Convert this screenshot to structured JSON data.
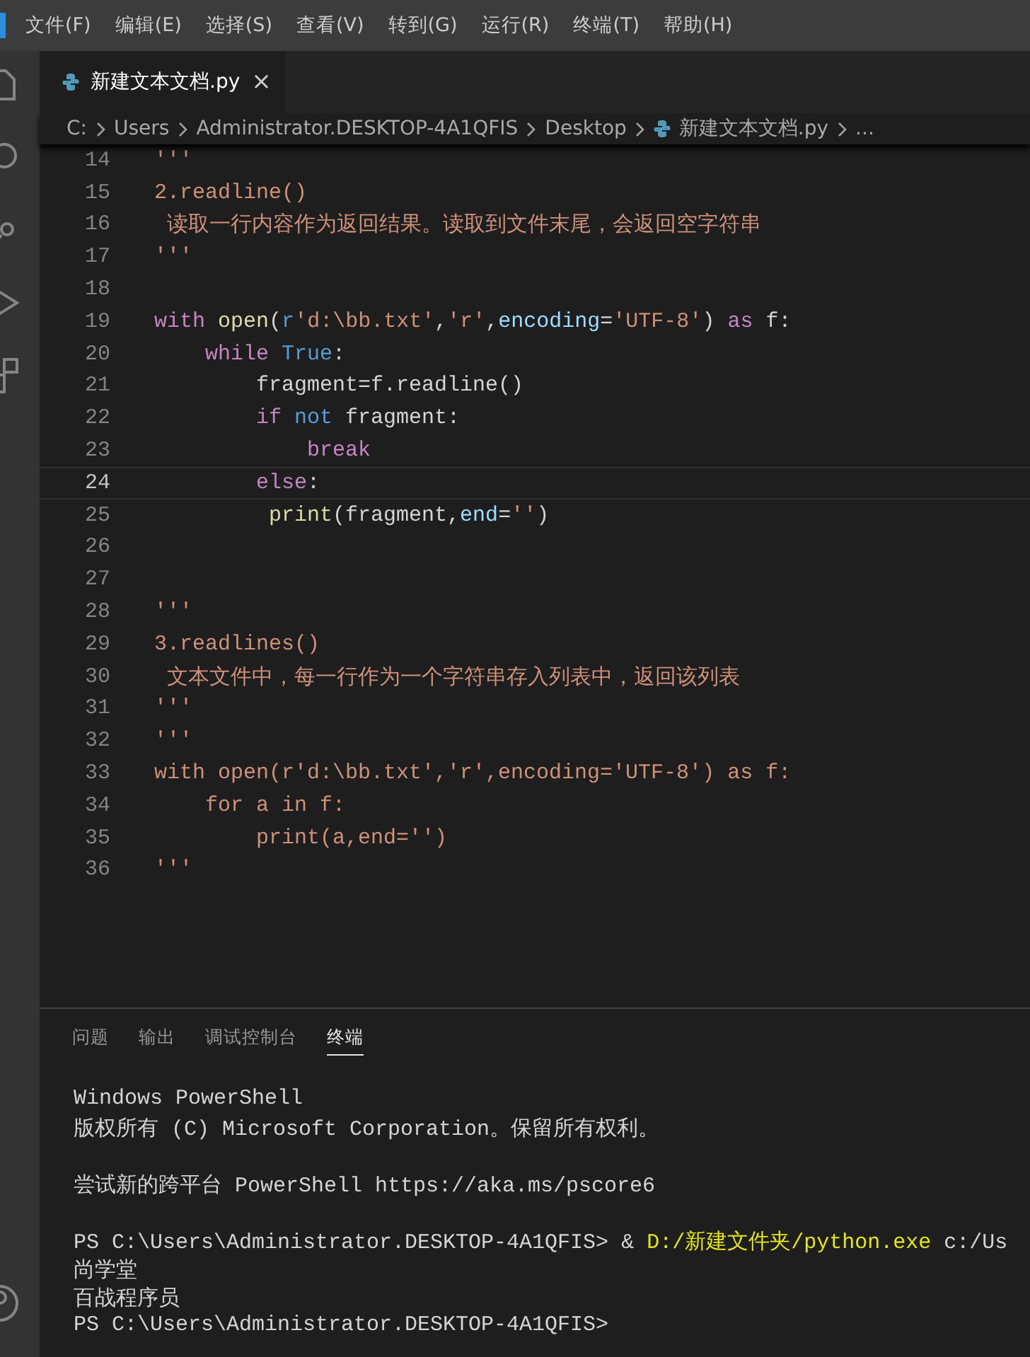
{
  "menu_bar": {
    "items": [
      "文件(F)",
      "编辑(E)",
      "选择(S)",
      "查看(V)",
      "转到(G)",
      "运行(R)",
      "终端(T)",
      "帮助(H)"
    ]
  },
  "tabs": [
    {
      "label": "新建文本文档.py",
      "selected": true
    }
  ],
  "tab_close": "×",
  "breadcrumb": [
    {
      "kind": "text",
      "label": "C:"
    },
    {
      "kind": "text",
      "label": "Users"
    },
    {
      "kind": "text",
      "label": "Administrator.DESKTOP-4A1QFIS"
    },
    {
      "kind": "text",
      "label": "Desktop"
    },
    {
      "kind": "file",
      "label": "新建文本文档.py"
    },
    {
      "kind": "text",
      "label": "..."
    }
  ],
  "code_lines": [
    {
      "number": "14",
      "current": false,
      "tokens": [
        {
          "kind": "str",
          "text": "'''"
        }
      ]
    },
    {
      "number": "15",
      "current": false,
      "tokens": [
        {
          "kind": "str",
          "text": "2.readline()"
        }
      ]
    },
    {
      "number": "16",
      "current": false,
      "tokens": [
        {
          "kind": "str",
          "text": " 读取一行内容作为返回结果。读取到文件末尾，会返回空字符串"
        }
      ]
    },
    {
      "number": "17",
      "current": false,
      "tokens": [
        {
          "kind": "str",
          "text": "'''"
        }
      ]
    },
    {
      "number": "18",
      "current": false
    },
    {
      "number": "19",
      "current": false,
      "tokens": [
        {
          "kind": "kw",
          "text": "with"
        },
        {
          "kind": "fn",
          "text": " open"
        },
        {
          "kind": "plain",
          "text": "("
        },
        {
          "kind": "kw2",
          "text": "r"
        },
        {
          "kind": "str",
          "text": "'d:\\bb.txt'"
        },
        {
          "kind": "plain",
          "text": ","
        },
        {
          "kind": "str",
          "text": "'r'"
        },
        {
          "kind": "plain",
          "text": ","
        },
        {
          "kind": "param",
          "text": "encoding"
        },
        {
          "kind": "plain",
          "text": "="
        },
        {
          "kind": "str",
          "text": "'UTF-8'"
        },
        {
          "kind": "plain",
          "text": ")"
        },
        {
          "kind": "kw",
          "text": " as"
        },
        {
          "kind": "plain",
          "text": " f:"
        }
      ]
    },
    {
      "number": "20",
      "current": false,
      "tokens": [
        {
          "kind": "kw",
          "text": "    while"
        },
        {
          "kind": "kw2",
          "text": " True"
        },
        {
          "kind": "plain",
          "text": ":"
        }
      ]
    },
    {
      "number": "21",
      "current": false,
      "tokens": [
        {
          "kind": "plain",
          "text": "        fragment=f.readline()"
        }
      ]
    },
    {
      "number": "22",
      "current": false,
      "tokens": [
        {
          "kind": "kw",
          "text": "        if"
        },
        {
          "kind": "kw2",
          "text": " not"
        },
        {
          "kind": "plain",
          "text": " fragment:"
        }
      ]
    },
    {
      "number": "23",
      "current": false,
      "tokens": [
        {
          "kind": "kw",
          "text": "            break"
        }
      ]
    },
    {
      "number": "24",
      "current": true,
      "tokens": [
        {
          "kind": "kw",
          "text": "        else"
        },
        {
          "kind": "plain",
          "text": ":"
        }
      ]
    },
    {
      "number": "25",
      "current": false,
      "tokens": [
        {
          "kind": "fn",
          "text": "         print"
        },
        {
          "kind": "plain",
          "text": "(fragment,"
        },
        {
          "kind": "param",
          "text": "end"
        },
        {
          "kind": "plain",
          "text": "="
        },
        {
          "kind": "str",
          "text": "''"
        },
        {
          "kind": "plain",
          "text": ")"
        }
      ]
    },
    {
      "number": "26",
      "current": false
    },
    {
      "number": "27",
      "current": false
    },
    {
      "number": "28",
      "current": false,
      "tokens": [
        {
          "kind": "str",
          "text": "'''"
        }
      ]
    },
    {
      "number": "29",
      "current": false,
      "tokens": [
        {
          "kind": "str",
          "text": "3.readlines()"
        }
      ]
    },
    {
      "number": "30",
      "current": false,
      "tokens": [
        {
          "kind": "str",
          "text": " 文本文件中，每一行作为一个字符串存入列表中，返回该列表"
        }
      ]
    },
    {
      "number": "31",
      "current": false,
      "tokens": [
        {
          "kind": "str",
          "text": "'''"
        }
      ]
    },
    {
      "number": "32",
      "current": false,
      "tokens": [
        {
          "kind": "str",
          "text": "'''"
        }
      ]
    },
    {
      "number": "33",
      "current": false,
      "tokens": [
        {
          "kind": "str",
          "text": "with open(r'd:\\bb.txt','r',encoding='UTF-8') as f:"
        }
      ]
    },
    {
      "number": "34",
      "current": false,
      "tokens": [
        {
          "kind": "str",
          "text": "    for a in f:"
        }
      ]
    },
    {
      "number": "35",
      "current": false,
      "tokens": [
        {
          "kind": "str",
          "text": "        print(a,end='')"
        }
      ]
    },
    {
      "number": "36",
      "current": false,
      "tokens": [
        {
          "kind": "str",
          "text": "'''"
        }
      ]
    }
  ],
  "panel_tabs": [
    {
      "label": "问题",
      "selected": false
    },
    {
      "label": "输出",
      "selected": false
    },
    {
      "label": "调试控制台",
      "selected": false
    },
    {
      "label": "终端",
      "selected": true
    }
  ],
  "terminal_blocks": [
    {
      "lines": [
        {
          "tokens": [
            {
              "kind": "plain",
              "text": "Windows PowerShell"
            }
          ]
        },
        {
          "tokens": [
            {
              "kind": "plain",
              "text": "版权所有 (C) Microsoft Corporation。保留所有权利。"
            }
          ]
        }
      ]
    },
    {
      "lines": [
        {
          "tokens": [
            {
              "kind": "plain",
              "text": "尝试新的跨平台 PowerShell https://aka.ms/pscore6"
            }
          ]
        }
      ]
    },
    {
      "lines": [
        {
          "tokens": [
            {
              "kind": "plain",
              "text": "PS C:\\Users\\Administrator.DESKTOP-4A1QFIS> &"
            },
            {
              "kind": "cmd",
              "text": " D:/新建文件夹/python.exe"
            },
            {
              "kind": "plain",
              "text": " c:/Us"
            }
          ]
        },
        {
          "tokens": [
            {
              "kind": "plain",
              "text": "尚学堂"
            }
          ]
        },
        {
          "tokens": [
            {
              "kind": "plain",
              "text": "百战程序员"
            }
          ]
        },
        {
          "tokens": [
            {
              "kind": "plain",
              "text": "PS C:\\Users\\Administrator.DESKTOP-4A1QFIS>"
            }
          ]
        }
      ]
    }
  ]
}
